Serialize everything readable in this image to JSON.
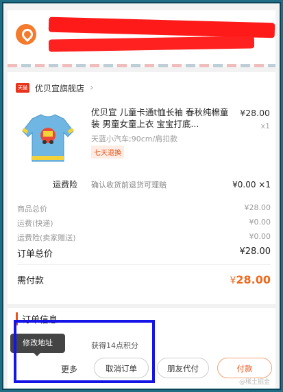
{
  "shop": {
    "badge": "天猫",
    "name": "优贝宜旗舰店"
  },
  "product": {
    "title": "优贝宜 儿童卡通t恤长袖 春秋纯棉童装 男童女童上衣 宝宝打底...",
    "price": "¥28.00",
    "quantity": "x1",
    "spec": "天蓝小汽车;90cm/肩扣款",
    "tag": "七天退换"
  },
  "insurance": {
    "label": "运费险",
    "desc": "确认收货前退货可理赔",
    "amount": "¥0.00 ×1"
  },
  "summary": {
    "rows": [
      {
        "label": "商品总价",
        "value": "¥28.00"
      },
      {
        "label": "运费(快递)",
        "value": "¥0.00"
      },
      {
        "label": "运费险(卖家赠送)",
        "value": "¥0.00"
      }
    ],
    "total_label": "订单总价",
    "total_value": "¥28.00",
    "due_label": "需付款",
    "due_currency": "¥",
    "due_value": "28.00"
  },
  "order_info": {
    "heading": "订单信息",
    "points": "获得14点积分"
  },
  "tooltip": "修改地址",
  "actions": {
    "more": "更多",
    "cancel": "取消订单",
    "friend_pay": "朋友代付",
    "pay": "付款"
  },
  "watermark": "@稀土掘金",
  "colors": {
    "accent": "#e8541c",
    "highlight_box": "#1414e6",
    "redaction": "#ff1a1a"
  }
}
